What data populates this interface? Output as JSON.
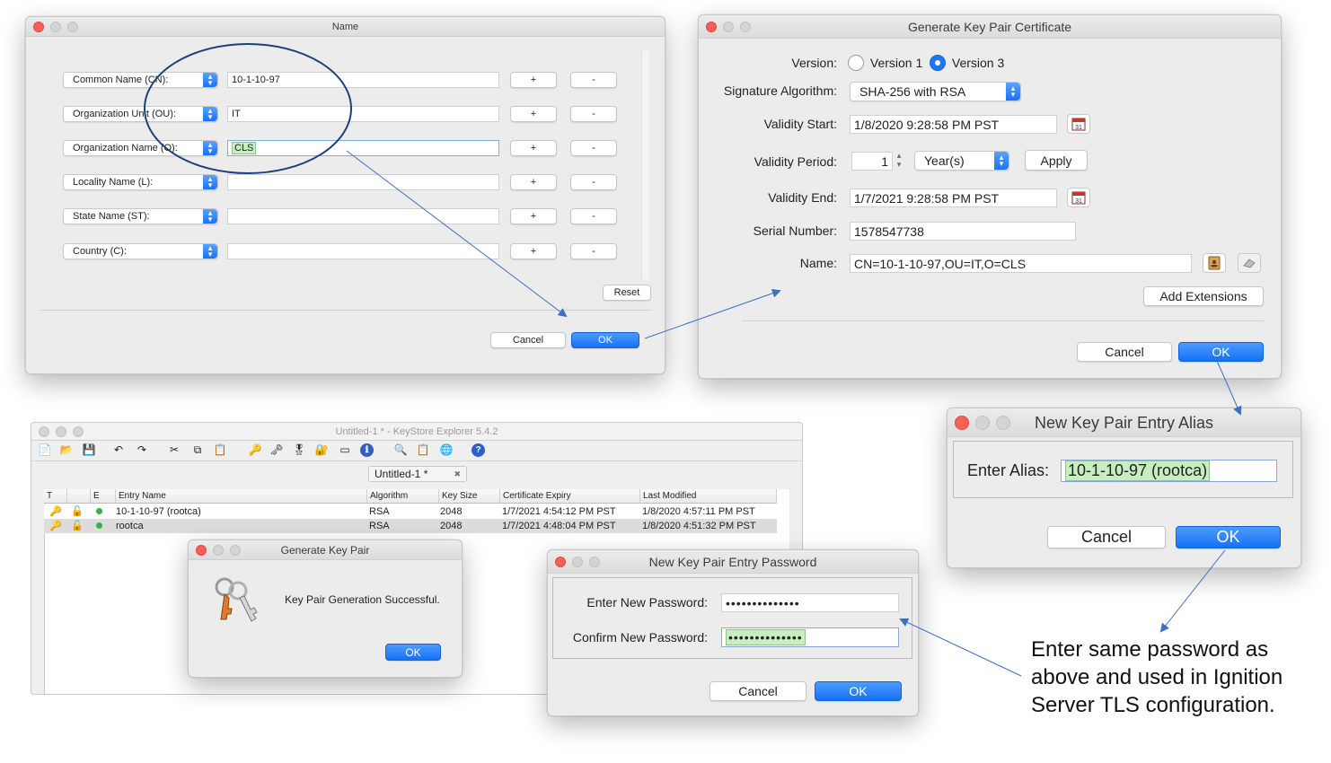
{
  "name_dialog": {
    "title": "Name",
    "rows": [
      {
        "type": "Common Name (CN):",
        "value": "10-1-10-97"
      },
      {
        "type": "Organization Unit (OU):",
        "value": "IT"
      },
      {
        "type": "Organization Name (O):",
        "value": "CLS"
      },
      {
        "type": "Locality Name (L):",
        "value": ""
      },
      {
        "type": "State Name (ST):",
        "value": ""
      },
      {
        "type": "Country (C):",
        "value": ""
      }
    ],
    "add_label": "+",
    "remove_label": "-",
    "reset_label": "Reset",
    "cancel_label": "Cancel",
    "ok_label": "OK"
  },
  "gen_cert_dialog": {
    "title": "Generate Key Pair Certificate",
    "version_label": "Version:",
    "version1_label": "Version 1",
    "version3_label": "Version 3",
    "selected_version": "Version 3",
    "sig_alg_label": "Signature Algorithm:",
    "sig_alg_value": "SHA-256 with RSA",
    "validity_start_label": "Validity Start:",
    "validity_start_value": "1/8/2020 9:28:58 PM PST",
    "validity_period_label": "Validity Period:",
    "validity_period_value": "1",
    "period_unit": "Year(s)",
    "apply_label": "Apply",
    "validity_end_label": "Validity End:",
    "validity_end_value": "1/7/2021 9:28:58 PM PST",
    "serial_label": "Serial Number:",
    "serial_value": "1578547738",
    "name_label": "Name:",
    "name_value": "CN=10-1-10-97,OU=IT,O=CLS",
    "add_extensions_label": "Add Extensions",
    "cancel_label": "Cancel",
    "ok_label": "OK"
  },
  "alias_dialog": {
    "title": "New Key Pair Entry Alias",
    "alias_label": "Enter Alias:",
    "alias_value": "10-1-10-97 (rootca)",
    "cancel_label": "Cancel",
    "ok_label": "OK"
  },
  "keystore_window": {
    "title": "Untitled-1 * - KeyStore Explorer 5.4.2",
    "tab_label": "Untitled-1 *",
    "tab_close": "✖",
    "columns": [
      "T",
      "",
      "E",
      "Entry Name",
      "Algorithm",
      "Key Size",
      "Certificate Expiry",
      "Last Modified"
    ],
    "entries": [
      {
        "name": "10-1-10-97 (rootca)",
        "algorithm": "RSA",
        "key_size": "2048",
        "expiry": "1/7/2021 4:54:12 PM PST",
        "modified": "1/8/2020 4:57:11 PM PST"
      },
      {
        "name": "rootca",
        "algorithm": "RSA",
        "key_size": "2048",
        "expiry": "1/7/2021 4:48:04 PM PST",
        "modified": "1/8/2020 4:51:32 PM PST"
      }
    ]
  },
  "gen_keypair_dialog": {
    "title": "Generate Key Pair",
    "message": "Key Pair Generation Successful.",
    "ok_label": "OK"
  },
  "password_dialog": {
    "title": "New Key Pair Entry Password",
    "new_label": "Enter New Password:",
    "new_value": "••••••••••••••",
    "confirm_label": "Confirm New Password:",
    "confirm_value": "••••••••••••••",
    "cancel_label": "Cancel",
    "ok_label": "OK"
  },
  "annotation": {
    "line1": "Enter same password as",
    "line2": "above and used in Ignition",
    "line3": "Server TLS configuration."
  },
  "colors": {
    "accent_blue": "#1671f3",
    "highlight_green": "#c6eec0",
    "annotation_line": "#3f6fc4"
  }
}
